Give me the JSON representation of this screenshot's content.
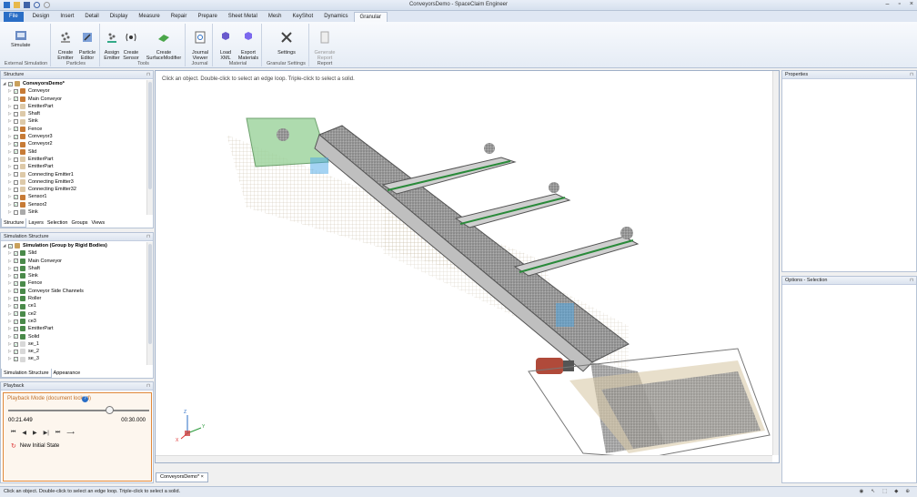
{
  "window": {
    "title": "ConveyorsDemo - SpaceClaim Engineer"
  },
  "ribbon_tabs": [
    "File",
    "Design",
    "Insert",
    "Detail",
    "Display",
    "Measure",
    "Repair",
    "Prepare",
    "Sheet Metal",
    "Mesh",
    "KeyShot",
    "Dynamics",
    "Granular"
  ],
  "ribbon": {
    "simulate": "Simulate",
    "external_simulation": "External Simulation",
    "create_emitter": "Create\nEmitter",
    "particle_editor": "Particle\nEditor",
    "particles": "Particles",
    "assign_emitter": "Assign\nEmitter",
    "create_sensor": "Create\nSensor",
    "create_surface_modifier": "Create\nSurfaceModifier",
    "tools": "Tools",
    "journal_viewer": "Journal\nViewer",
    "journal": "Journal",
    "load_xml": "Load\nXML",
    "export_materials": "Export\nMaterials",
    "material": "Material",
    "settings": "Settings",
    "granular_settings": "Granular Settings",
    "generate_report": "Generate\nReport",
    "report": "Report"
  },
  "structure": {
    "title": "Structure",
    "items": [
      {
        "label": "ConveyorsDemo*",
        "bold": true,
        "color": "#c9a15c"
      },
      {
        "label": "Conveyor",
        "color": "#c77b36"
      },
      {
        "label": "Main Conveyor",
        "color": "#c77b36"
      },
      {
        "label": "EmitterPart",
        "color": "#ddc9a8"
      },
      {
        "label": "Shaft",
        "color": "#ddc9a8"
      },
      {
        "label": "Sink",
        "color": "#ddc9a8"
      },
      {
        "label": "Fence",
        "color": "#c77b36"
      },
      {
        "label": "Conveyor3",
        "color": "#c77b36"
      },
      {
        "label": "Conveyor2",
        "color": "#c77b36"
      },
      {
        "label": "Slid",
        "color": "#c77b36"
      },
      {
        "label": "EmitterPart",
        "color": "#ddc9a8"
      },
      {
        "label": "EmitterPart",
        "color": "#ddc9a8"
      },
      {
        "label": "Connecting Emitter1",
        "color": "#ddc9a8"
      },
      {
        "label": "Connecting Emitter3",
        "color": "#ddc9a8"
      },
      {
        "label": "Connecting Emitter32",
        "color": "#ddc9a8"
      },
      {
        "label": "Sensor1",
        "color": "#c77b36"
      },
      {
        "label": "Sensor2",
        "color": "#c77b36"
      },
      {
        "label": "Sink",
        "color": "#aaaaaa"
      }
    ],
    "tabs": [
      "Structure",
      "Layers",
      "Selection",
      "Groups",
      "Views"
    ]
  },
  "sim_structure": {
    "title": "Simulation Structure",
    "root": "Simulation (Group by Rigid Bodies)",
    "items": [
      "Slid",
      "Main Conveyor",
      "Shaft",
      "Sink",
      "Fence",
      "Conveyor  Side Channels",
      "Roller",
      "ce1",
      "ce2",
      "ce3",
      "EmitterPart",
      "Solid",
      "se_1",
      "se_2",
      "se_3"
    ],
    "tabs": [
      "Simulation Structure",
      "Appearance"
    ]
  },
  "playback": {
    "title": "Playback",
    "mode": "Playback Mode (document locked)",
    "current_time": "00:21.449",
    "end_time": "00:30.000",
    "progress": 0.72,
    "new_initial_state": "New Initial State"
  },
  "viewport": {
    "hint": "Click an object. Double-click to select an edge loop. Triple-click to select a solid."
  },
  "properties": {
    "title": "Properties"
  },
  "options": {
    "title": "Options - Selection"
  },
  "document_tab": "ConveyorsDemo*",
  "status": {
    "text": "Click an object. Double-click to select an edge loop. Triple-click to select a solid."
  },
  "colors": {
    "accent": "#2a6ec6",
    "playback_border": "#e0883a",
    "belt": "#a9a9a9",
    "particle": "#7a7a7a",
    "sensor": "#4aa8e8"
  }
}
